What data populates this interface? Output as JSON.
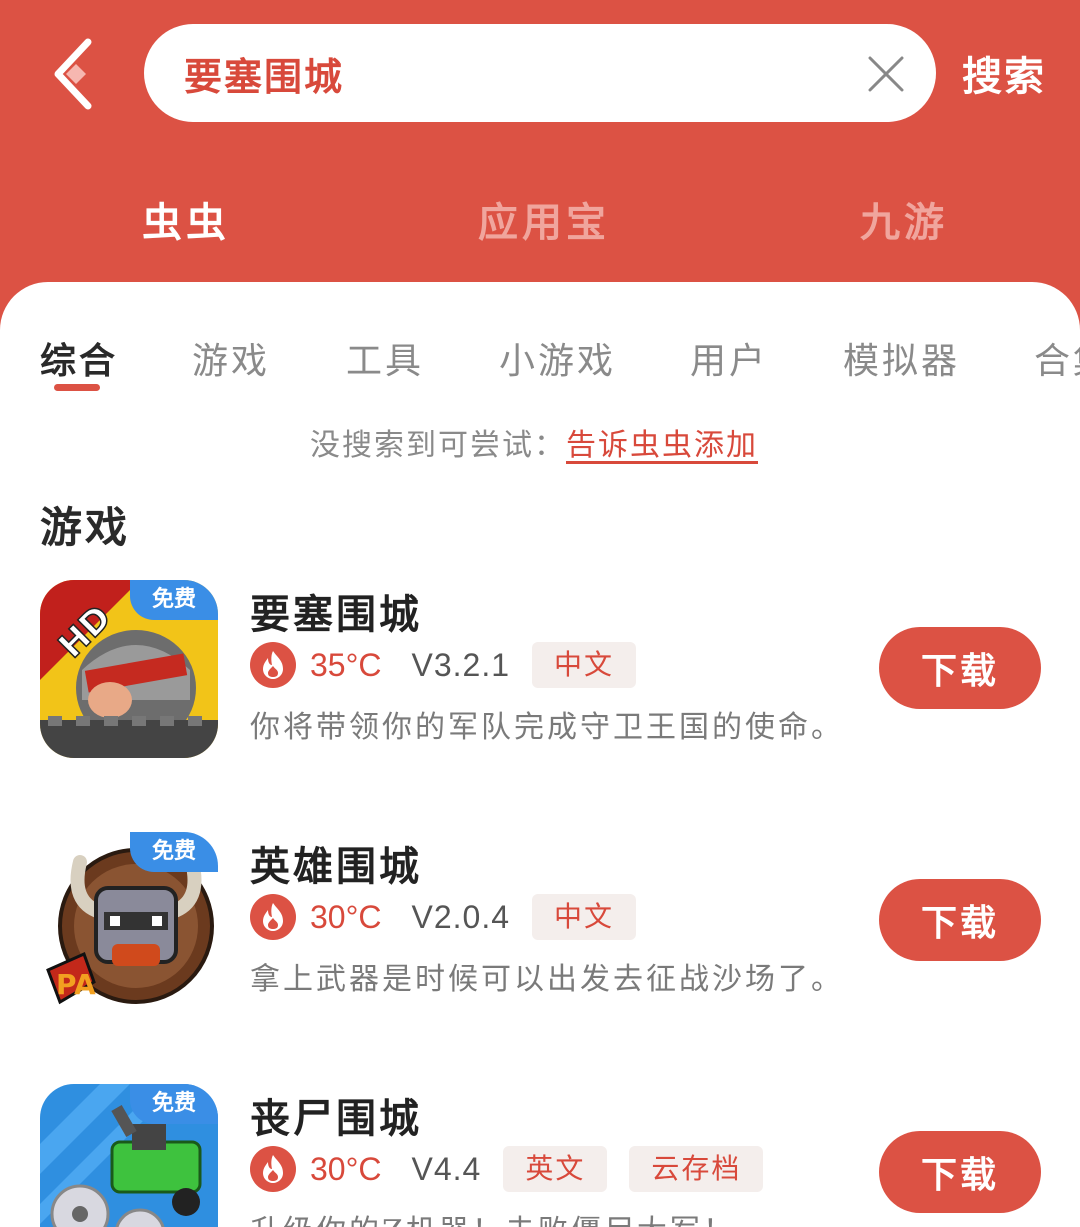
{
  "header": {
    "search_value": "要塞围城",
    "search_button": "搜索",
    "source_tabs": [
      "虫虫",
      "应用宝",
      "九游"
    ]
  },
  "categories": [
    "综合",
    "游戏",
    "工具",
    "小游戏",
    "用户",
    "模拟器",
    "合集"
  ],
  "hint": {
    "text": "没搜索到可尝试：",
    "link": "告诉虫虫添加"
  },
  "section_title": "游戏",
  "games": [
    {
      "name": "要塞围城",
      "badge": "免费",
      "heat": "35°C",
      "version": "V3.2.1",
      "tags": [
        "中文"
      ],
      "desc": "你将带领你的军队完成守卫王国的使命。",
      "download": "下载",
      "icon_text": "HD"
    },
    {
      "name": "英雄围城",
      "badge": "免费",
      "heat": "30°C",
      "version": "V2.0.4",
      "tags": [
        "中文"
      ],
      "desc": "拿上武器是时候可以出发去征战沙场了。",
      "download": "下载",
      "icon_text": "PA"
    },
    {
      "name": "丧尸围城",
      "badge": "免费",
      "heat": "30°C",
      "version": "V4.4",
      "tags": [
        "英文",
        "云存档"
      ],
      "desc": "升级你的Z机器！击败僵尸大军！",
      "download": "下载"
    }
  ],
  "colors": {
    "brand": "#dc5244",
    "badge": "#3a8ee6",
    "tag_bg": "#f4eeec"
  },
  "icons": [
    "back-arrow-icon",
    "clear-icon",
    "fire-icon"
  ]
}
